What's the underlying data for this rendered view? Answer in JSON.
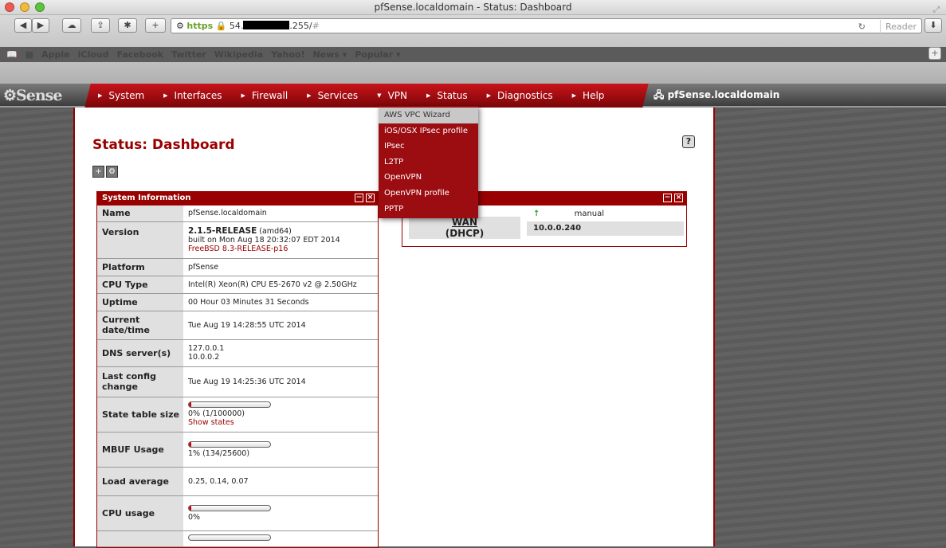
{
  "window": {
    "title": "pfSense.localdomain - Status: Dashboard"
  },
  "browser": {
    "url_scheme": "https",
    "url_host_prefix": "54.",
    "url_host_suffix": ".255/",
    "url_hash": "#",
    "reader_label": "Reader",
    "bookmarks": [
      "Apple",
      "iCloud",
      "Facebook",
      "Twitter",
      "Wikipedia",
      "Yahoo!",
      "News ▾",
      "Popular ▾"
    ]
  },
  "nav": {
    "logo": "Sense",
    "items": [
      "System",
      "Interfaces",
      "Firewall",
      "Services",
      "VPN",
      "Status",
      "Diagnostics",
      "Help"
    ],
    "host": "pfSense.localdomain"
  },
  "vpn_menu": [
    "AWS VPC Wizard",
    "iOS/OSX IPsec profile",
    "IPsec",
    "L2TP",
    "OpenVPN",
    "OpenVPN profile",
    "PPTP"
  ],
  "page": {
    "title": "Status: Dashboard",
    "help": "?"
  },
  "sysinfo": {
    "title": "System Information",
    "name_k": "Name",
    "name_v": "pfSense.localdomain",
    "version_k": "Version",
    "version_rel": "2.1.5-RELEASE",
    "version_arch": "(amd64)",
    "version_built": "built on Mon Aug 18 20:32:07 EDT 2014",
    "version_bsd": "FreeBSD 8.3-RELEASE-p16",
    "platform_k": "Platform",
    "platform_v": "pfSense",
    "cpu_k": "CPU Type",
    "cpu_v": "Intel(R) Xeon(R) CPU E5-2670 v2 @ 2.50GHz",
    "uptime_k": "Uptime",
    "uptime_v": "00 Hour 03 Minutes 31 Seconds",
    "dt_k": "Current date/time",
    "dt_v": "Tue Aug 19 14:28:55 UTC 2014",
    "dns_k": "DNS server(s)",
    "dns_1": "127.0.0.1",
    "dns_2": "10.0.0.2",
    "lc_k": "Last config change",
    "lc_v": "Tue Aug 19 14:25:36 UTC 2014",
    "state_k": "State table size",
    "state_v": "0% (1/100000)",
    "state_link": "Show states",
    "state_pct": 0.01,
    "mbuf_k": "MBUF Usage",
    "mbuf_v": "1% (134/25600)",
    "mbuf_pct": 0.01,
    "load_k": "Load average",
    "load_v": "0.25, 0.14, 0.07",
    "cpu_usage_k": "CPU usage",
    "cpu_usage_v": "0%",
    "cpu_pct": 0.01
  },
  "interfaces": {
    "wan_name": "WAN",
    "wan_type": "(DHCP)",
    "wan_mode": "manual",
    "wan_ip": "10.0.0.240",
    "status": "up"
  }
}
